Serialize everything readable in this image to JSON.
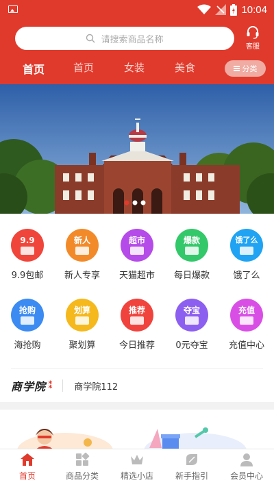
{
  "status_bar": {
    "time": "10:04"
  },
  "header": {
    "search_placeholder": "请搜索商品名称",
    "service_label": "客服",
    "tabs": [
      {
        "label": "首页",
        "active": true
      },
      {
        "label": "首页",
        "active": false
      },
      {
        "label": "女装",
        "active": false
      },
      {
        "label": "美食",
        "active": false
      }
    ],
    "category_button": "分类"
  },
  "grid": {
    "items": [
      {
        "icon_text": "9.9",
        "label": "9.9包邮",
        "color": "#f0453a",
        "icon": "nine-nine-icon"
      },
      {
        "icon_text": "新人",
        "label": "新人专享",
        "color": "#f38a2a",
        "icon": "gift-icon"
      },
      {
        "icon_text": "超市",
        "label": "天猫超市",
        "color": "#b54be8",
        "icon": "basket-icon"
      },
      {
        "icon_text": "爆款",
        "label": "每日爆款",
        "color": "#33c86a",
        "icon": "flame-icon"
      },
      {
        "icon_text": "饿了么",
        "label": "饿了么",
        "color": "#1fa3f2",
        "icon": "eleme-icon"
      },
      {
        "icon_text": "抢购",
        "label": "海抢购",
        "color": "#3b8bf2",
        "icon": "lightning-icon"
      },
      {
        "icon_text": "划算",
        "label": "聚划算",
        "color": "#f5b81d",
        "icon": "yuan-bag-icon"
      },
      {
        "icon_text": "推荐",
        "label": "今日推荐",
        "color": "#f0433d",
        "icon": "tag-icon"
      },
      {
        "icon_text": "夺宝",
        "label": "0元夺宝",
        "color": "#8d5ff0",
        "icon": "crown-icon"
      },
      {
        "icon_text": "充值",
        "label": "充值中心",
        "color": "#d94fe6",
        "icon": "phone-icon"
      }
    ]
  },
  "business_school": {
    "logo_text": "商学院",
    "text": "商学院112"
  },
  "bottom_nav": {
    "items": [
      {
        "label": "首页",
        "active": true
      },
      {
        "label": "商品分类",
        "active": false
      },
      {
        "label": "精选小店",
        "active": false
      },
      {
        "label": "新手指引",
        "active": false
      },
      {
        "label": "会员中心",
        "active": false
      }
    ]
  },
  "colors": {
    "brand": "#e03a2c",
    "active_nav": "#e03a2c"
  }
}
